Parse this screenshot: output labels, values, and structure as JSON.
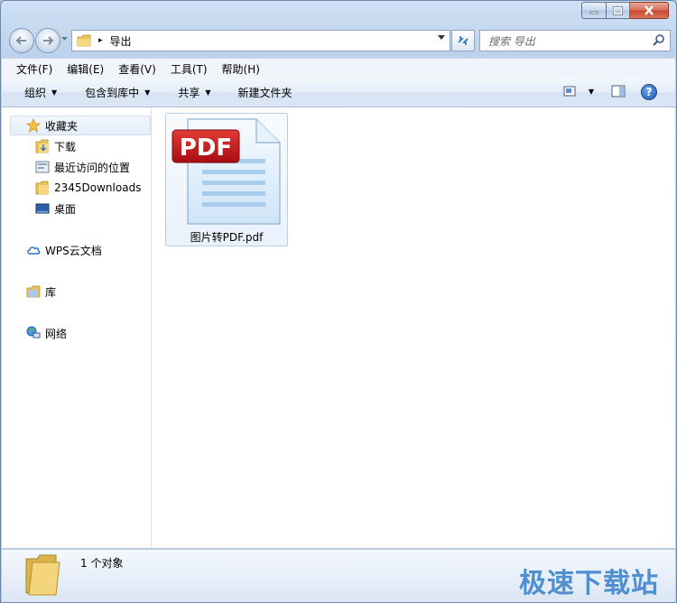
{
  "window": {
    "buttons": [
      "minimize",
      "maximize",
      "close"
    ]
  },
  "address": {
    "path": "导出",
    "separator": "▸"
  },
  "search": {
    "placeholder": "搜索 导出"
  },
  "menu": [
    "文件(F)",
    "编辑(E)",
    "查看(V)",
    "工具(T)",
    "帮助(H)"
  ],
  "commands": {
    "organize": "组织",
    "include_in_library": "包含到库中",
    "share": "共享",
    "new_folder": "新建文件夹"
  },
  "nav": {
    "favorites": "收藏夹",
    "downloads": "下载",
    "recent": "最近访问的位置",
    "d2345": "2345Downloads",
    "desktop": "桌面",
    "wps": "WPS云文档",
    "library": "库",
    "network": "网络"
  },
  "files": [
    {
      "name": "图片转PDF.pdf",
      "badge": "PDF"
    }
  ],
  "status": {
    "count": "1 个对象"
  },
  "watermark": "极速下载站",
  "colors": {
    "pdf_red": "#c8151b",
    "accent": "#1f5bb3"
  }
}
